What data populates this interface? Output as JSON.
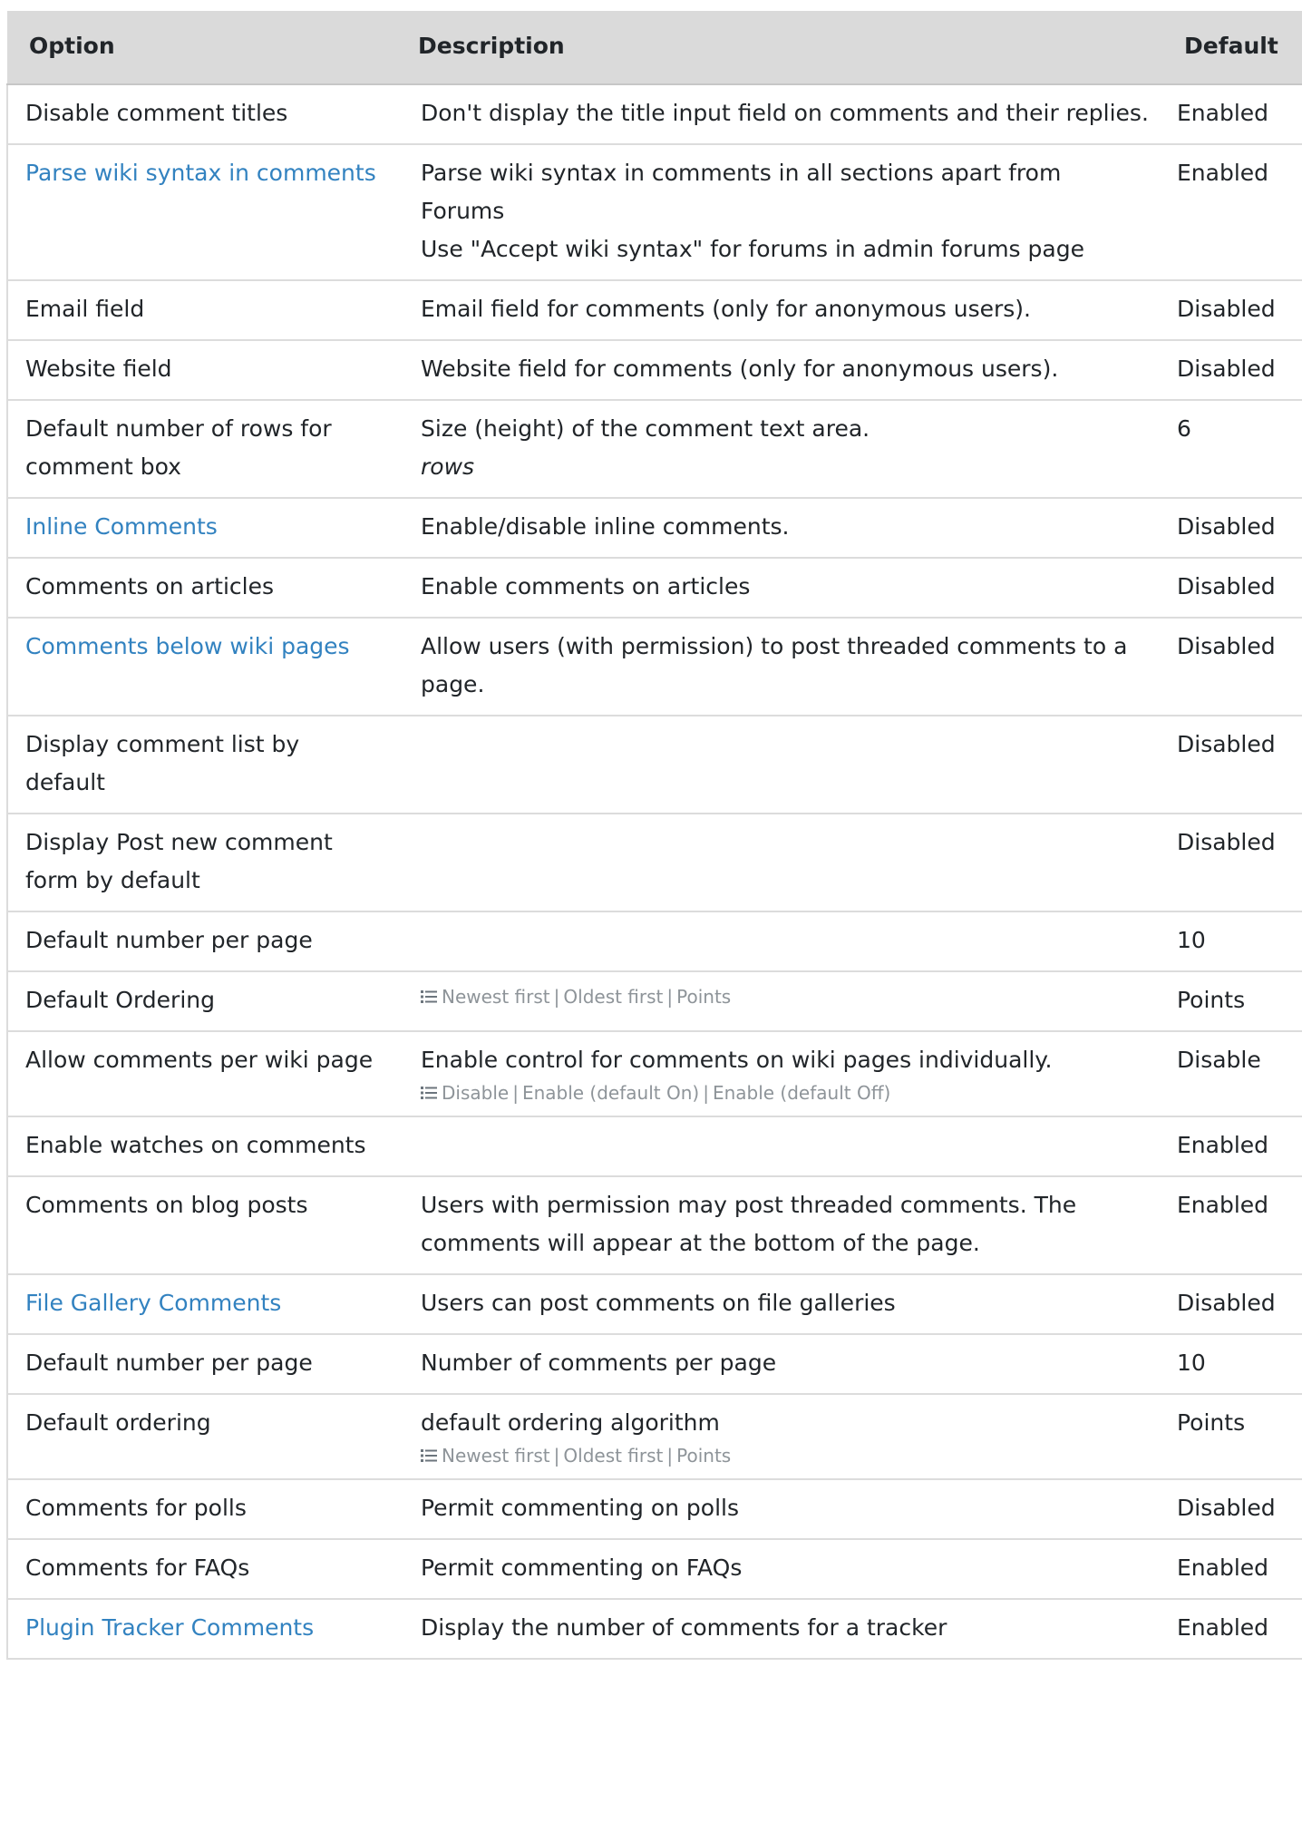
{
  "table": {
    "headers": {
      "option": "Option",
      "description": "Description",
      "default": "Default"
    },
    "rows": [
      {
        "option": "Disable comment titles",
        "link": false,
        "description": "Don't display the title input field on comments and their replies.",
        "default": "Enabled"
      },
      {
        "option": "Parse wiki syntax in comments",
        "link": true,
        "description": "Parse wiki syntax in comments in all sections apart from Forums",
        "description_extra": "Use \"Accept wiki syntax\" for forums in admin forums page",
        "default": "Enabled"
      },
      {
        "option": "Email field",
        "link": false,
        "description": "Email field for comments (only for anonymous users).",
        "default": "Disabled"
      },
      {
        "option": "Website field",
        "link": false,
        "description": "Website field for comments (only for anonymous users).",
        "default": "Disabled"
      },
      {
        "option": "Default number of rows for comment box",
        "link": false,
        "description": "Size (height) of the comment text area.",
        "unit": "rows",
        "default": "6"
      },
      {
        "option": "Inline Comments",
        "link": true,
        "description": "Enable/disable inline comments.",
        "default": "Disabled"
      },
      {
        "option": "Comments on articles",
        "link": false,
        "description": "Enable comments on articles",
        "default": "Disabled"
      },
      {
        "option": "Comments below wiki pages",
        "link": true,
        "description": "Allow users (with permission) to post threaded comments to a page.",
        "default": "Disabled"
      },
      {
        "option": "Display comment list by default",
        "link": false,
        "description": "",
        "default": "Disabled"
      },
      {
        "option": "Display Post new comment form by default",
        "link": false,
        "description": "",
        "default": "Disabled"
      },
      {
        "option": "Default number per page",
        "link": false,
        "description": "",
        "default": "10"
      },
      {
        "option": "Default Ordering",
        "link": false,
        "description": "",
        "choices": [
          "Newest first",
          "Oldest first",
          "Points"
        ],
        "choices_icon": "list-icon",
        "default": "Points"
      },
      {
        "option": "Allow comments per wiki page",
        "link": false,
        "description": "Enable control for comments on wiki pages individually.",
        "choices": [
          "Disable",
          "Enable (default On)",
          "Enable (default Off)"
        ],
        "choices_icon": "list-icon",
        "default": "Disable"
      },
      {
        "option": "Enable watches on comments",
        "link": false,
        "description": "",
        "default": "Enabled"
      },
      {
        "option": "Comments on blog posts",
        "link": false,
        "description": "Users with permission may post threaded comments. The comments will appear at the bottom of the page.",
        "default": "Enabled"
      },
      {
        "option": "File Gallery Comments",
        "link": true,
        "description": "Users can post comments on file galleries",
        "default": "Disabled"
      },
      {
        "option": "Default number per page",
        "link": false,
        "description": "Number of comments per page",
        "default": "10"
      },
      {
        "option": "Default ordering",
        "link": false,
        "description": "default ordering algorithm",
        "choices": [
          "Newest first",
          "Oldest first",
          "Points"
        ],
        "choices_icon": "list-icon",
        "default": "Points"
      },
      {
        "option": "Comments for polls",
        "link": false,
        "description": "Permit commenting on polls",
        "default": "Disabled"
      },
      {
        "option": "Comments for FAQs",
        "link": false,
        "description": "Permit commenting on FAQs",
        "default": "Enabled"
      },
      {
        "option": "Plugin Tracker Comments",
        "link": true,
        "description": "Display the number of comments for a tracker",
        "default": "Enabled"
      }
    ]
  },
  "colors": {
    "header_bg": "#dadada",
    "link": "#3282c0",
    "border": "#dcdcdc",
    "muted": "#8e9499"
  }
}
